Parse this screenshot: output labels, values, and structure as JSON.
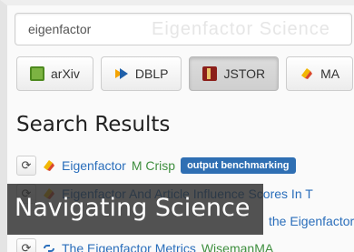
{
  "search": {
    "value": "eigenfactor",
    "ghost_text": "Eigenfactor Science"
  },
  "sources": [
    {
      "label": "arXiv",
      "icon": "arxiv-icon"
    },
    {
      "label": "DBLP",
      "icon": "dblp-icon"
    },
    {
      "label": "JSTOR",
      "icon": "jstor-icon"
    },
    {
      "label": "MA",
      "icon": "ma-icon"
    }
  ],
  "results_heading": "Search Results",
  "results": [
    {
      "title": "Eigenfactor",
      "author": "M Crisp",
      "tag": "output benchmarking",
      "icon": "tag-icon"
    },
    {
      "title": "Eigenfactor And Article Influence Scores In T",
      "icon": "tag-icon"
    },
    {
      "title": "the Eigenfactor",
      "icon": "tag-icon"
    },
    {
      "title": "The Eigenfactor Metrics",
      "author": "WisemanMA",
      "icon": "link-icon"
    }
  ],
  "overlay": {
    "caption": "Navigating Science"
  },
  "colors": {
    "link": "#2a6ebb",
    "author": "#3f8f3f",
    "tag_bg": "#2f6fb3",
    "overlay_bg": "#2d2d2d"
  }
}
